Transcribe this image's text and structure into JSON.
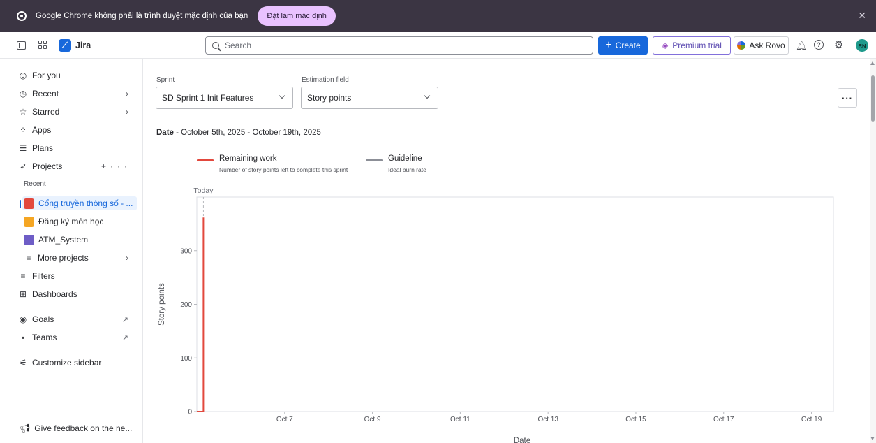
{
  "banner": {
    "message": "Google Chrome không phải là trình duyệt mặc định của bạn",
    "button_label": "Đặt làm mặc định",
    "close_glyph": "✕"
  },
  "topnav": {
    "app_name": "Jira",
    "search_placeholder": "Search",
    "create_label": "Create",
    "premium_label": "Premium trial",
    "rovo_label": "Ask Rovo",
    "avatar_initials": "RN"
  },
  "sidebar": {
    "items": [
      {
        "label": "For you",
        "icon": "person-circle-icon"
      },
      {
        "label": "Recent",
        "icon": "clock-icon"
      },
      {
        "label": "Starred",
        "icon": "star-icon"
      },
      {
        "label": "Apps",
        "icon": "apps-icon"
      },
      {
        "label": "Plans",
        "icon": "plans-icon"
      },
      {
        "label": "Projects",
        "icon": "rocket-icon"
      }
    ],
    "recent_label": "Recent",
    "projects": [
      {
        "label": "Cổng truyền thông số - ...",
        "color": "#e2483d",
        "selected": true
      },
      {
        "label": "Đăng ký môn học",
        "color": "#f5a623",
        "selected": false
      },
      {
        "label": "ATM_System",
        "color": "#6e5dc6",
        "selected": false
      }
    ],
    "more_projects": "More projects",
    "filters": "Filters",
    "dashboards": "Dashboards",
    "goals": "Goals",
    "teams": "Teams",
    "customize": "Customize sidebar",
    "feedback": "Give feedback on the ne..."
  },
  "filters": {
    "sprint_label": "Sprint",
    "sprint_value": "SD Sprint 1 Init Features",
    "estimation_label": "Estimation field",
    "estimation_value": "Story points",
    "more_glyph": "···"
  },
  "date_range": {
    "prefix": "Date",
    "value": " - October 5th, 2025 - October 19th, 2025"
  },
  "legend": [
    {
      "title": "Remaining work",
      "subtitle": "Number of story points left to complete this sprint",
      "color": "#e2483d"
    },
    {
      "title": "Guideline",
      "subtitle": "Ideal burn rate",
      "color": "#8c8f97"
    }
  ],
  "chart_data": {
    "type": "line",
    "today_label": "Today",
    "today_x": 5.15,
    "xlabel": "Date",
    "ylabel": "Story points",
    "xlim": [
      5,
      19.5
    ],
    "ylim": [
      0,
      400
    ],
    "x_ticks": [
      {
        "x": 7,
        "label": "Oct 7"
      },
      {
        "x": 9,
        "label": "Oct 9"
      },
      {
        "x": 11,
        "label": "Oct 11"
      },
      {
        "x": 13,
        "label": "Oct 13"
      },
      {
        "x": 15,
        "label": "Oct 15"
      },
      {
        "x": 17,
        "label": "Oct 17"
      },
      {
        "x": 19,
        "label": "Oct 19"
      }
    ],
    "y_ticks": [
      0,
      100,
      200,
      300
    ],
    "series": [
      {
        "name": "Remaining work",
        "color": "#e2483d",
        "points": [
          [
            5,
            0
          ],
          [
            5.15,
            0
          ],
          [
            5.15,
            362
          ]
        ]
      }
    ]
  }
}
